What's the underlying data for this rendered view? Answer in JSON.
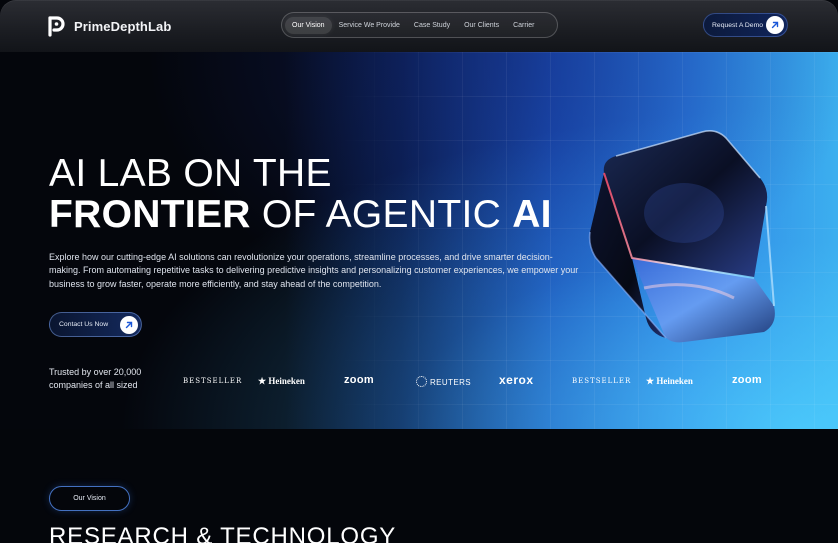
{
  "header": {
    "brand": "PrimeDepthLab",
    "nav": [
      {
        "label": "Our Vision",
        "active": true
      },
      {
        "label": "Service We Provide",
        "active": false
      },
      {
        "label": "Case Study",
        "active": false
      },
      {
        "label": "Our Clients",
        "active": false
      },
      {
        "label": "Carrier",
        "active": false
      }
    ],
    "cta_label": "Request A Demo"
  },
  "hero": {
    "title_line1": "AI LAB ON THE",
    "title_bold1": "FRONTIER",
    "title_mid": " OF AGENTIC ",
    "title_bold2": "AI",
    "description": "Explore how our cutting-edge AI solutions can revolutionize your operations, streamline processes, and drive smarter decision-making. From automating repetitive tasks to delivering predictive insights and personalizing customer experiences, we empower your business to grow faster, operate more efficiently, and stay ahead of the competition.",
    "cta_label": "Contact Us Now",
    "trusted_text": "Trusted by over 20,000 companies of all sized",
    "brands": [
      "BESTSELLER",
      "Heineken",
      "zoom",
      "REUTERS",
      "xerox",
      "BESTSELLER",
      "Heineken",
      "zoom"
    ]
  },
  "section": {
    "pill_label": "Our Vision",
    "heading": "RESEARCH & TECHNOLOGY"
  },
  "colors": {
    "accent": "#1f5fd6",
    "background": "#04060b",
    "highlight": "#3cb0ef"
  },
  "icons": [
    "logo-mark-icon",
    "arrow-up-right-icon",
    "star-icon",
    "reuters-dots-icon"
  ]
}
